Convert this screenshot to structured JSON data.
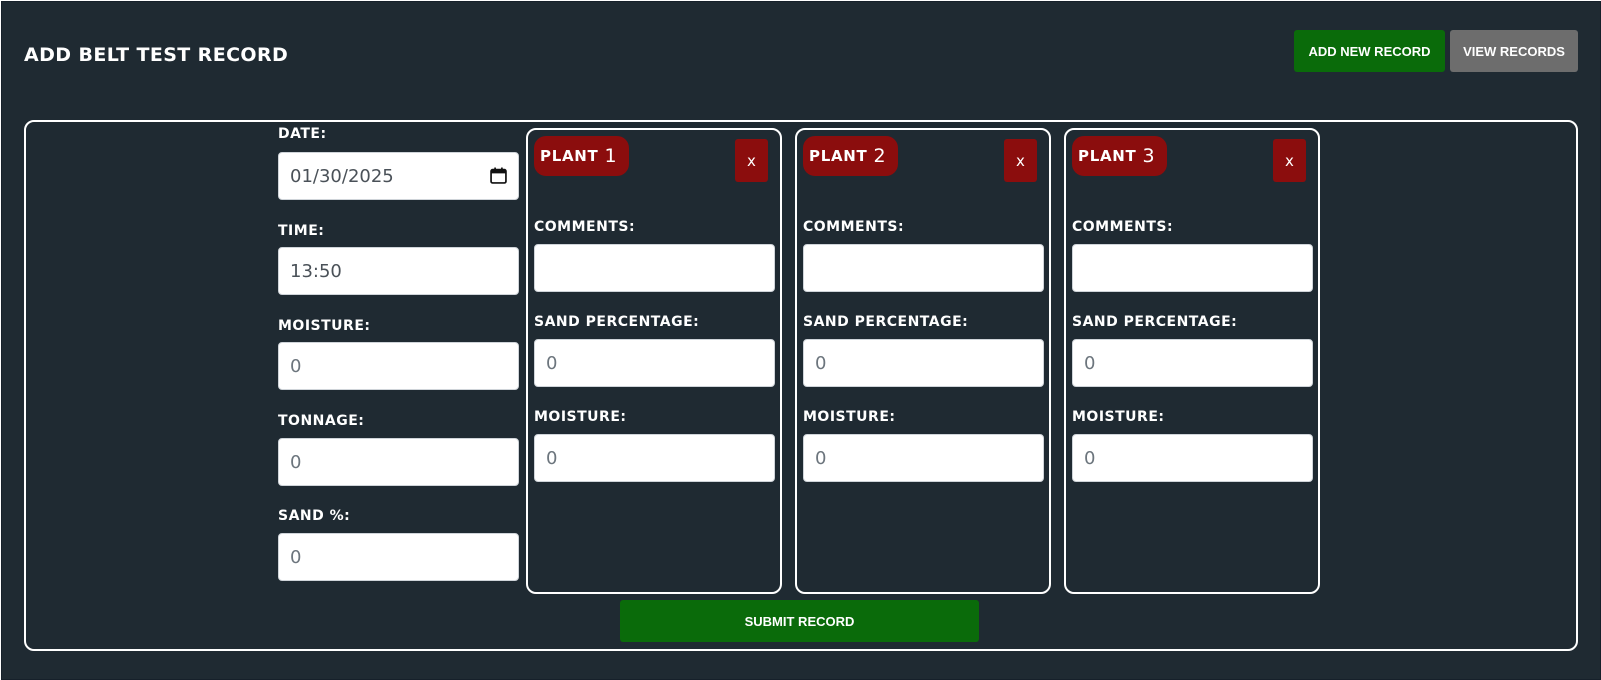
{
  "header": {
    "title": "ADD BELT TEST RECORD",
    "add_new_label": "ADD NEW RECORD",
    "view_records_label": "VIEW RECORDS"
  },
  "main_fields": {
    "date": {
      "label": "DATE:",
      "value": "01/30/2025",
      "icon": "calendar-icon"
    },
    "time": {
      "label": "TIME:",
      "value": "13:50"
    },
    "moisture": {
      "label": "MOISTURE:",
      "placeholder": "0"
    },
    "tonnage": {
      "label": "TONNAGE:",
      "placeholder": "0"
    },
    "sand": {
      "label": "SAND %:",
      "placeholder": "0"
    }
  },
  "plants": [
    {
      "name": "PLANT",
      "number": "1",
      "remove_label": "x",
      "comments_label": "COMMENTS:",
      "comments_value": "",
      "sand_label": "SAND PERCENTAGE:",
      "sand_placeholder": "0",
      "moisture_label": "MOISTURE:",
      "moisture_placeholder": "0"
    },
    {
      "name": "PLANT",
      "number": "2",
      "remove_label": "x",
      "comments_label": "COMMENTS:",
      "comments_value": "",
      "sand_label": "SAND PERCENTAGE:",
      "sand_placeholder": "0",
      "moisture_label": "MOISTURE:",
      "moisture_placeholder": "0"
    },
    {
      "name": "PLANT",
      "number": "3",
      "remove_label": "x",
      "comments_label": "COMMENTS:",
      "comments_value": "",
      "sand_label": "SAND PERCENTAGE:",
      "sand_placeholder": "0",
      "moisture_label": "MOISTURE:",
      "moisture_placeholder": "0"
    }
  ],
  "submit_label": "SUBMIT RECORD",
  "colors": {
    "background": "#1f2a32",
    "primary_green": "#0a6b0a",
    "secondary_gray": "#6d6d6d",
    "danger_red": "#8b0d0d",
    "border": "#ffffff"
  }
}
